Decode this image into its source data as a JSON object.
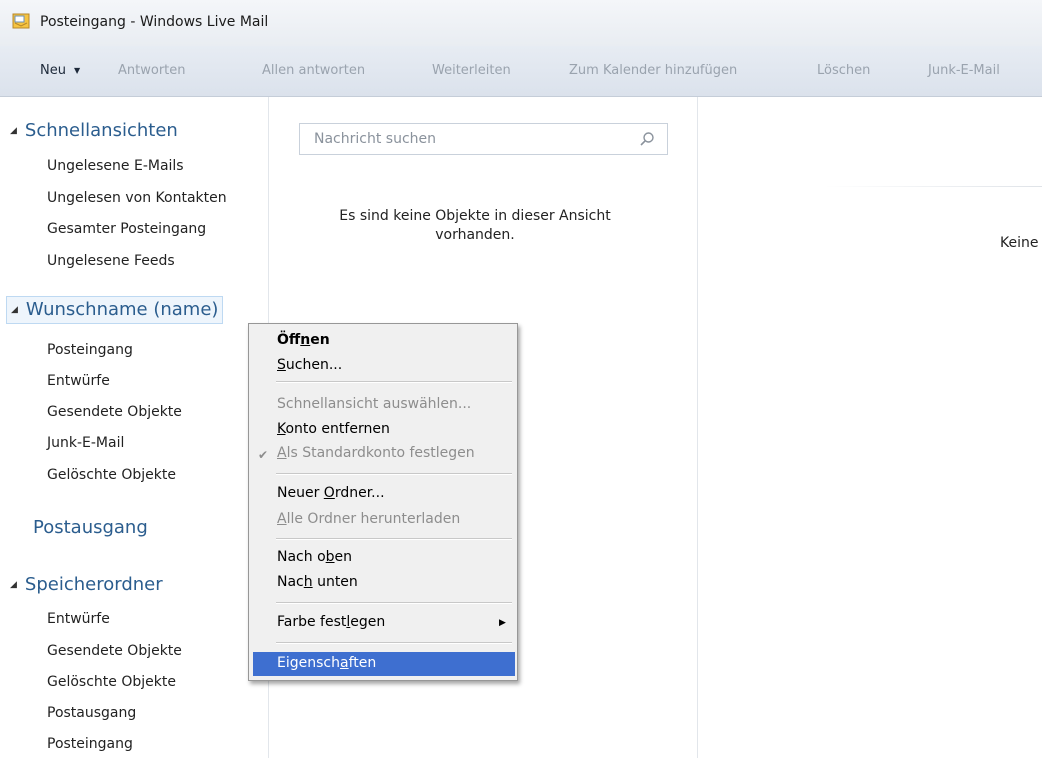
{
  "window": {
    "title": "Posteingang - Windows Live Mail"
  },
  "toolbar": {
    "new_label": "Neu",
    "reply": "Antworten",
    "reply_all": "Allen antworten",
    "forward": "Weiterleiten",
    "add_calendar": "Zum Kalender hinzufügen",
    "delete": "Löschen",
    "junk": "Junk-E-Mail"
  },
  "nav": {
    "quick_views": {
      "label": "Schnellansichten",
      "items": [
        "Ungelesene E-Mails",
        "Ungelesen von Kontakten",
        "Gesamter Posteingang",
        "Ungelesene Feeds"
      ]
    },
    "account": {
      "label": "Wunschname (name)",
      "items": [
        "Posteingang",
        "Entwürfe",
        "Gesendete Objekte",
        "Junk-E-Mail",
        "Gelöschte Objekte"
      ]
    },
    "outbox": "Postausgang",
    "storage": {
      "label": "Speicherordner",
      "items": [
        "Entwürfe",
        "Gesendete Objekte",
        "Gelöschte Objekte",
        "Postausgang",
        "Posteingang"
      ]
    }
  },
  "list": {
    "search_placeholder": "Nachricht suchen",
    "empty_line1": "Es sind keine Objekte in dieser Ansicht",
    "empty_line2": "vorhanden."
  },
  "reading": {
    "text": "Keine"
  },
  "context_menu": {
    "open_a": "Öff",
    "open_u": "n",
    "open_b": "en",
    "search_u": "S",
    "search_b": "uchen...",
    "quickview": "Schnellansicht auswählen...",
    "remove_u": "K",
    "remove_b": "onto entfernen",
    "default_u": "A",
    "default_b": "ls Standardkonto festlegen",
    "newfolder_a": "Neuer ",
    "newfolder_u": "O",
    "newfolder_b": "rdner...",
    "download_a": "A",
    "download_b": "lle Ordner herunterladen",
    "up_a": "Nach o",
    "up_u": "b",
    "up_b": "en",
    "down_a": "Nac",
    "down_u": "h",
    "down_b": " unten",
    "color_a": "Farbe fest",
    "color_u": "l",
    "color_b": "egen",
    "props_a": "Eigensch",
    "props_u": "a",
    "props_b": "ften"
  }
}
